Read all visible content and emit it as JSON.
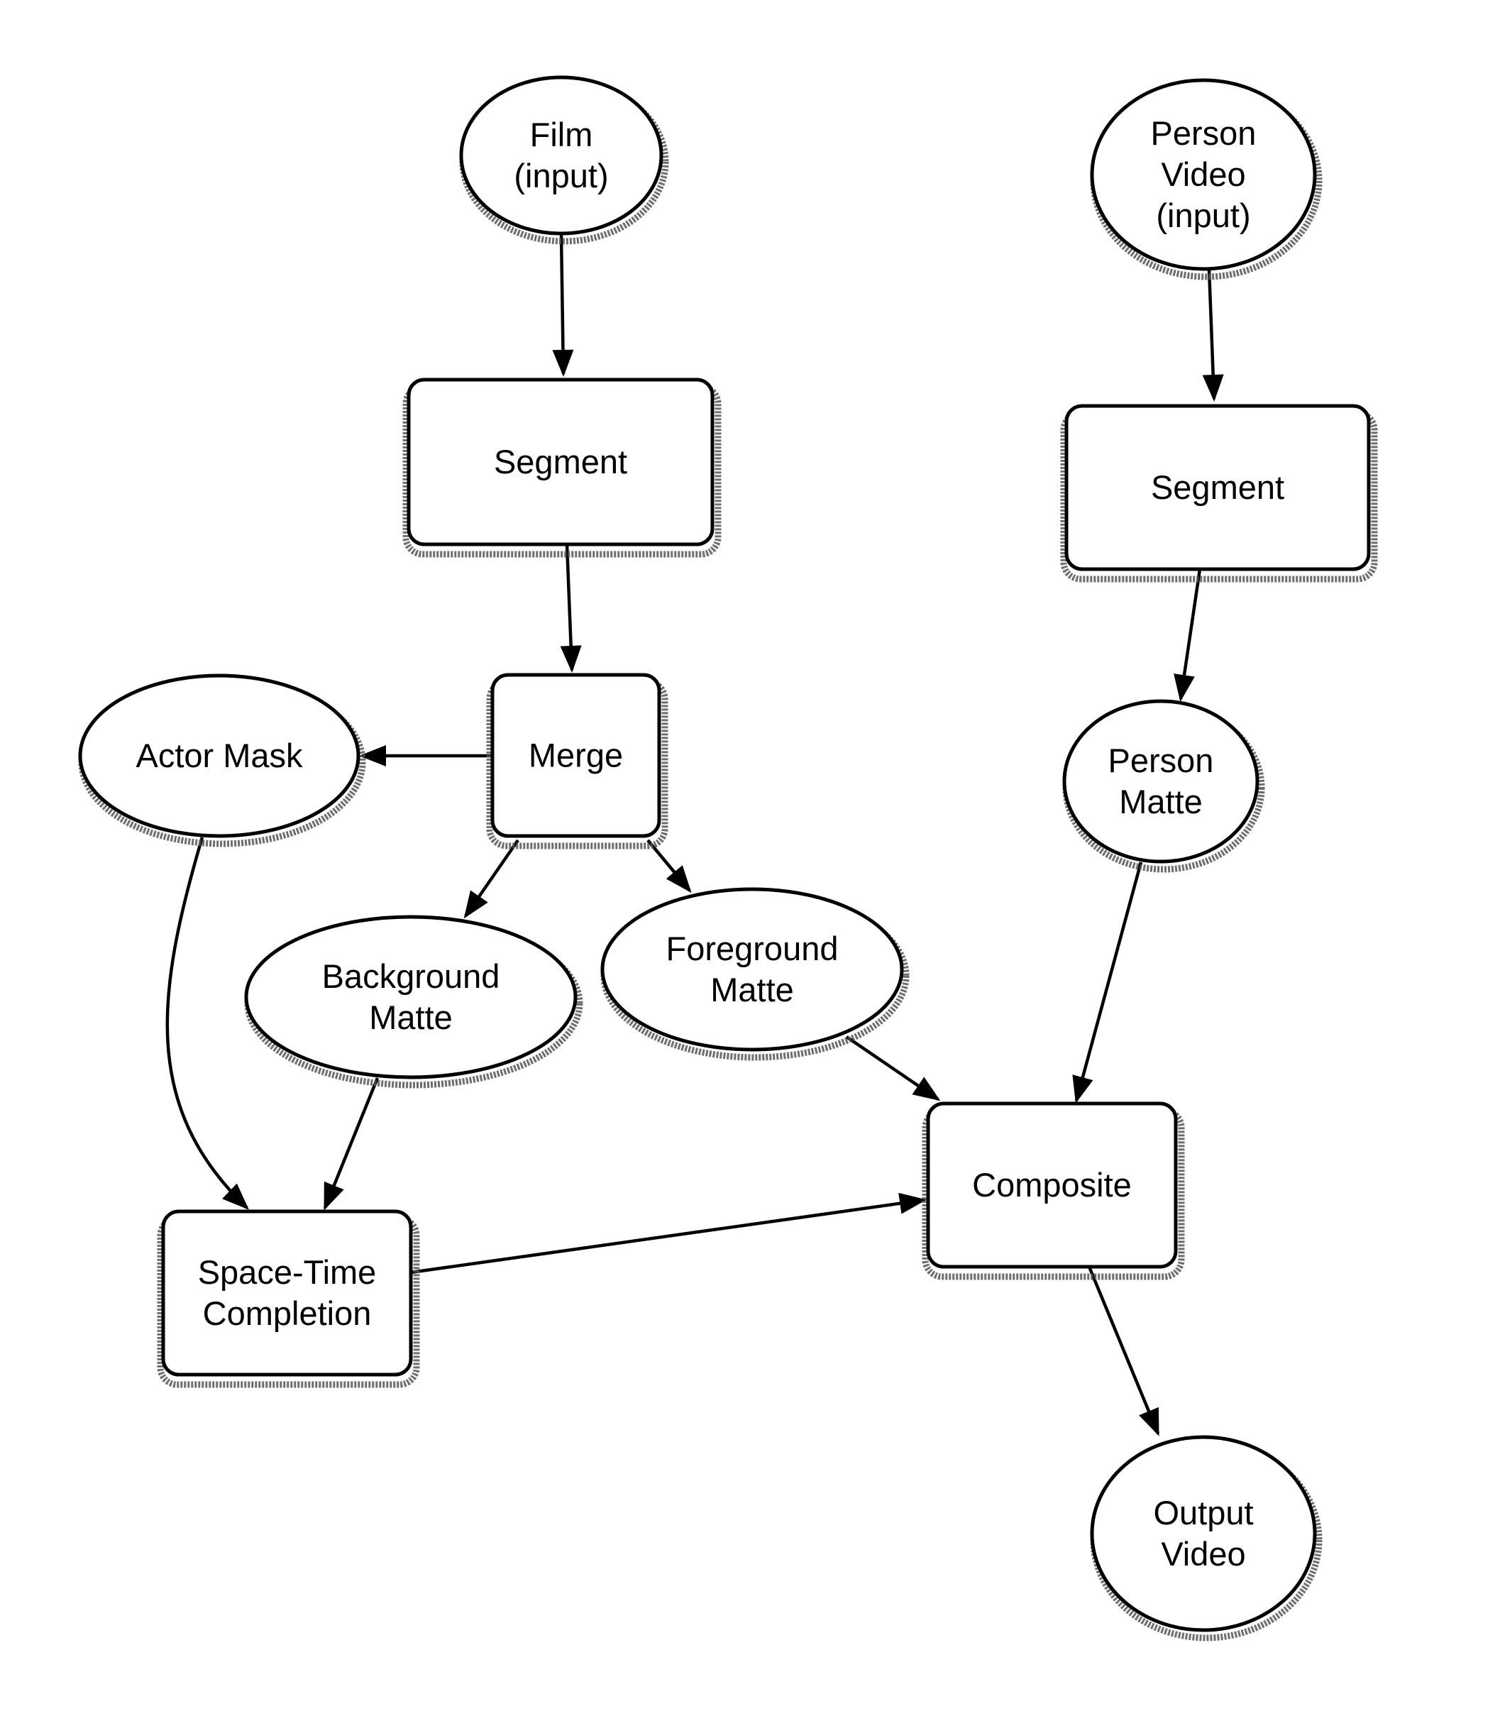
{
  "diagram": {
    "nodes": [
      {
        "id": "film",
        "shape": "ellipse",
        "lines": [
          "Film",
          "(input)"
        ]
      },
      {
        "id": "person-video",
        "shape": "ellipse",
        "lines": [
          "Person",
          "Video",
          "(input)"
        ]
      },
      {
        "id": "segment-film",
        "shape": "box",
        "lines": [
          "Segment"
        ]
      },
      {
        "id": "segment-person",
        "shape": "box",
        "lines": [
          "Segment"
        ]
      },
      {
        "id": "merge",
        "shape": "box",
        "lines": [
          "Merge"
        ]
      },
      {
        "id": "actor-mask",
        "shape": "ellipse",
        "lines": [
          "Actor Mask"
        ]
      },
      {
        "id": "person-matte",
        "shape": "ellipse",
        "lines": [
          "Person",
          "Matte"
        ]
      },
      {
        "id": "background-matte",
        "shape": "ellipse",
        "lines": [
          "Background",
          "Matte"
        ]
      },
      {
        "id": "foreground-matte",
        "shape": "ellipse",
        "lines": [
          "Foreground",
          "Matte"
        ]
      },
      {
        "id": "composite",
        "shape": "box",
        "lines": [
          "Composite"
        ]
      },
      {
        "id": "space-time-completion",
        "shape": "box",
        "lines": [
          "Space-Time",
          "Completion"
        ]
      },
      {
        "id": "output-video",
        "shape": "ellipse",
        "lines": [
          "Output",
          "Video"
        ]
      }
    ],
    "edges": [
      {
        "from": "film",
        "to": "segment-film"
      },
      {
        "from": "segment-film",
        "to": "merge"
      },
      {
        "from": "merge",
        "to": "actor-mask"
      },
      {
        "from": "merge",
        "to": "background-matte"
      },
      {
        "from": "merge",
        "to": "foreground-matte"
      },
      {
        "from": "actor-mask",
        "to": "space-time-completion"
      },
      {
        "from": "background-matte",
        "to": "space-time-completion"
      },
      {
        "from": "foreground-matte",
        "to": "composite"
      },
      {
        "from": "person-video",
        "to": "segment-person"
      },
      {
        "from": "segment-person",
        "to": "person-matte"
      },
      {
        "from": "person-matte",
        "to": "composite"
      },
      {
        "from": "space-time-completion",
        "to": "composite"
      },
      {
        "from": "composite",
        "to": "output-video"
      }
    ]
  }
}
